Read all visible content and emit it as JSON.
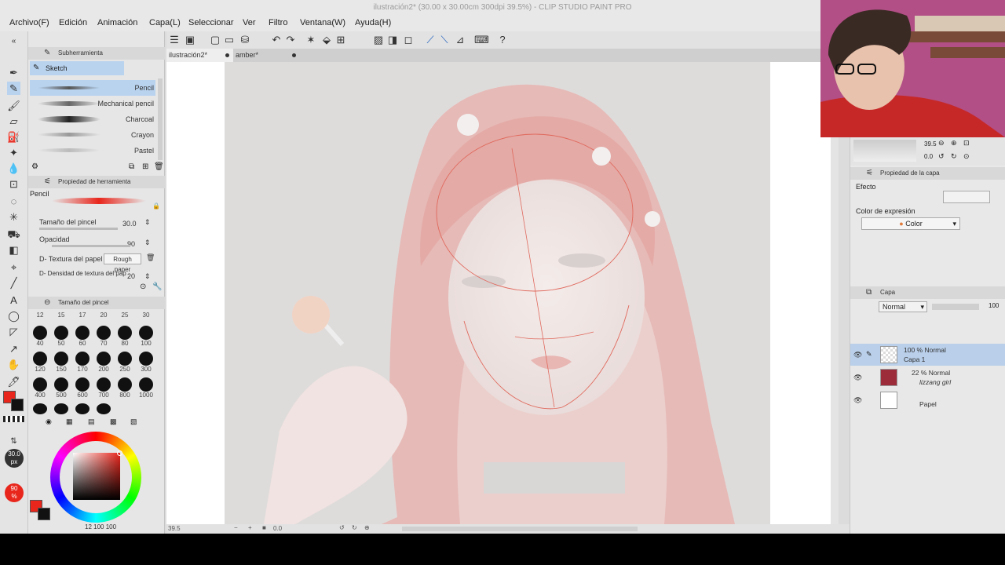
{
  "titlebar": {
    "title": "ilustración2* (30.00 x 30.00cm 300dpi 39.5%)  - CLIP STUDIO PAINT PRO"
  },
  "menubar": {
    "items": [
      "Archivo(F)",
      "Edición",
      "Animación",
      "Capa(L)",
      "Seleccionar",
      "Ver",
      "Filtro",
      "Ventana(W)",
      "Ayuda(H)"
    ]
  },
  "tabs": [
    {
      "label": "ilustración2*"
    },
    {
      "label": "amber*"
    }
  ],
  "subtool": {
    "header": "Subherramienta",
    "group": "Sketch",
    "brushes": [
      "Pencil",
      "Mechanical pencil",
      "Charcoal",
      "Crayon",
      "Pastel"
    ]
  },
  "tool_property": {
    "header": "Propiedad de herramienta",
    "tool_name": "Pencil",
    "brush_size_label": "Tamaño del pincel",
    "brush_size_value": "30.0",
    "opacity_label": "Opacidad",
    "opacity_value": "90",
    "paper_texture_label": "D- Textura del papel",
    "paper_texture_value": "Rough paper",
    "texture_density_label": "D- Densidad de textura del pap",
    "texture_density_value": "20"
  },
  "brush_size_panel": {
    "header": "Tamaño del pincel",
    "top_sizes": [
      "12",
      "15",
      "17",
      "20",
      "25",
      "30"
    ],
    "sizes": [
      "40",
      "50",
      "60",
      "70",
      "80",
      "100",
      "120",
      "150",
      "170",
      "200",
      "250",
      "300",
      "400",
      "500",
      "600",
      "700",
      "800",
      "1000"
    ]
  },
  "left_status": {
    "size": "30.0",
    "size_unit": "px",
    "opacity": "90",
    "opacity_unit": "%",
    "bottom_values": "12  100  100"
  },
  "colors": {
    "main": "#e8261c",
    "sub": "#111111",
    "accent": "#b9d3ef"
  },
  "statusbar": {
    "zoom": "39.5",
    "angle": "0.0"
  },
  "navigator": {
    "zoom": "39.5",
    "angle": "0.0"
  },
  "layer_property": {
    "header": "Propiedad de la capa",
    "effect_label": "Efecto",
    "expression_color_label": "Color de expresión",
    "expression_color_value": "Color"
  },
  "layers_panel": {
    "header": "Capa",
    "blend_mode": "Normal",
    "opacity": "100",
    "layers": [
      {
        "meta": "100 % Normal",
        "name": "Capa 1"
      },
      {
        "meta": "22 % Normal",
        "name": "lizzang girl"
      },
      {
        "meta": "",
        "name": "Papel"
      }
    ]
  }
}
